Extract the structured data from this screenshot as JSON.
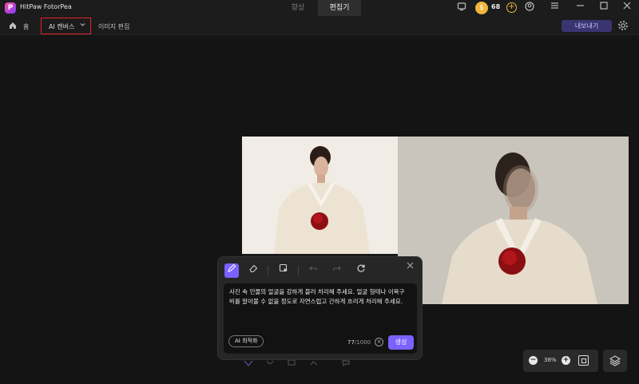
{
  "titlebar": {
    "app_title": "HitPaw FotorPea",
    "logo_letter": "P",
    "tabs": [
      {
        "label": "향상",
        "active": false
      },
      {
        "label": "편집기",
        "active": true
      }
    ],
    "credits": "68",
    "icons": [
      "screen-icon",
      "coin-icon",
      "add-credits-icon",
      "user-icon",
      "menu-icon",
      "minimize-icon",
      "maximize-icon",
      "close-icon"
    ]
  },
  "toolbar": {
    "home_label": "홈",
    "ai_canvas_label": "AI 캔버스",
    "image_edit_label": "이미지 편집",
    "export_label": "내보내기"
  },
  "dialog": {
    "prompt": "사진 속 인물의 얼굴을 강하게 블러 처리해 주세요. 얼굴 형태나 이목구비를 알아볼 수 없을 정도로 자연스럽고 간하게 흐리게 처리해 주세요.",
    "ai_optimize_label": "AI 최적화",
    "char_count": "77",
    "char_limit": "/1000",
    "generate_label": "생성"
  },
  "zoom": {
    "value": "38%"
  },
  "colors": {
    "accent": "#7b61ff",
    "highlight_box": "#e0262b",
    "background": "#141414"
  }
}
